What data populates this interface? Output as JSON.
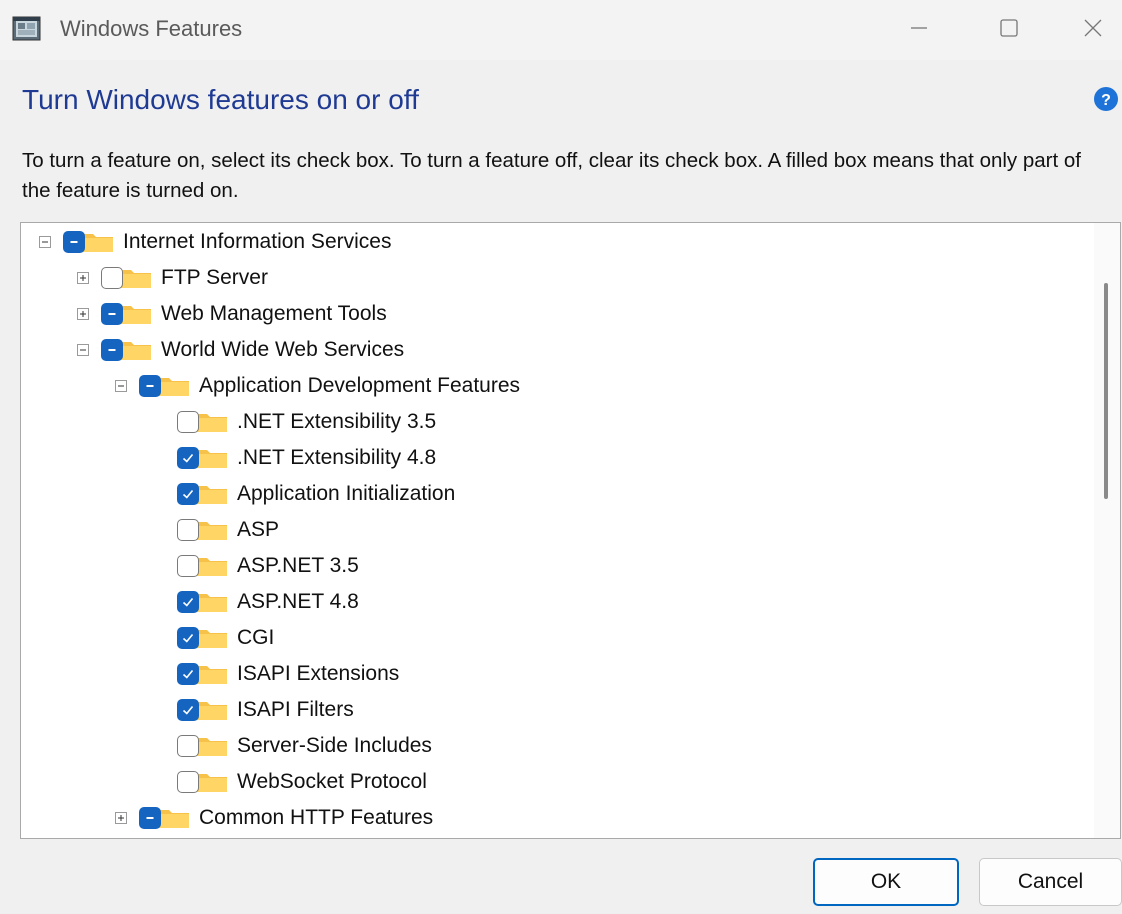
{
  "window": {
    "title": "Windows Features"
  },
  "heading": "Turn Windows features on or off",
  "instructions": "To turn a feature on, select its check box. To turn a feature off, clear its check box. A filled box means that only part of the feature is turned on.",
  "tree": [
    {
      "label": "Internet Information Services",
      "state": "partial",
      "expander": "collapse",
      "level": 0
    },
    {
      "label": "FTP Server",
      "state": "unchecked",
      "expander": "expand",
      "level": 1
    },
    {
      "label": "Web Management Tools",
      "state": "partial",
      "expander": "expand",
      "level": 1
    },
    {
      "label": "World Wide Web Services",
      "state": "partial",
      "expander": "collapse",
      "level": 1
    },
    {
      "label": "Application Development Features",
      "state": "partial",
      "expander": "collapse",
      "level": 2
    },
    {
      "label": ".NET Extensibility 3.5",
      "state": "unchecked",
      "expander": "none",
      "level": 3
    },
    {
      "label": ".NET Extensibility 4.8",
      "state": "checked",
      "expander": "none",
      "level": 3
    },
    {
      "label": "Application Initialization",
      "state": "checked",
      "expander": "none",
      "level": 3
    },
    {
      "label": "ASP",
      "state": "unchecked",
      "expander": "none",
      "level": 3
    },
    {
      "label": "ASP.NET 3.5",
      "state": "unchecked",
      "expander": "none",
      "level": 3
    },
    {
      "label": "ASP.NET 4.8",
      "state": "checked",
      "expander": "none",
      "level": 3
    },
    {
      "label": "CGI",
      "state": "checked",
      "expander": "none",
      "level": 3
    },
    {
      "label": "ISAPI Extensions",
      "state": "checked",
      "expander": "none",
      "level": 3
    },
    {
      "label": "ISAPI Filters",
      "state": "checked",
      "expander": "none",
      "level": 3
    },
    {
      "label": "Server-Side Includes",
      "state": "unchecked",
      "expander": "none",
      "level": 3
    },
    {
      "label": "WebSocket Protocol",
      "state": "unchecked",
      "expander": "none",
      "level": 3
    },
    {
      "label": "Common HTTP Features",
      "state": "partial",
      "expander": "expand",
      "level": 2
    }
  ],
  "buttons": {
    "ok": "OK",
    "cancel": "Cancel"
  },
  "colors": {
    "accent": "#1565c0",
    "heading": "#1f3a93",
    "folder": "#f6c24a"
  }
}
